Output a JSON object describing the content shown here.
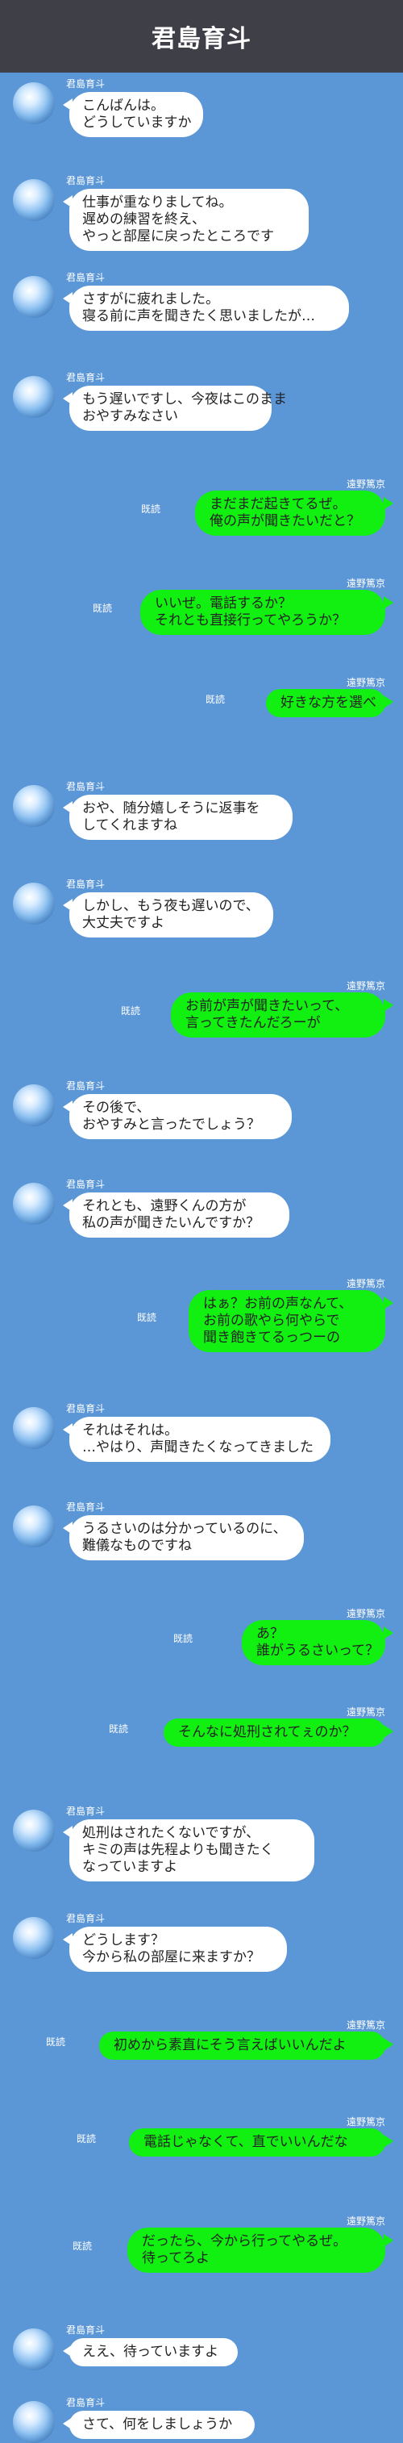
{
  "header": {
    "title": "君島育斗"
  },
  "read_label": "既読",
  "messages": [
    {
      "side": "left",
      "sender": "君島育斗",
      "text": "こんばんは。\nどうしていますか"
    },
    {
      "side": "left",
      "sender": "君島育斗",
      "text": "仕事が重なりましてね。\n遅めの練習を終え、\nやっと部屋に戻ったところです"
    },
    {
      "side": "left",
      "sender": "君島育斗",
      "text": "さすがに疲れました。\n寝る前に声を聞きたく思いましたが…"
    },
    {
      "side": "left",
      "sender": "君島育斗",
      "text": "もう遅いですし、今夜はこのまま\nおやすみなさい"
    },
    {
      "side": "right",
      "sender": "遠野篤京",
      "read": "既読",
      "text": "まだまだ起きてるぜ。\n俺の声が聞きたいだと？"
    },
    {
      "side": "right",
      "sender": "遠野篤京",
      "read": "既読",
      "text": "いいぜ。電話するか？\nそれとも直接行ってやろうか？"
    },
    {
      "side": "right",
      "sender": "遠野篤京",
      "read": "既読",
      "text": "好きな方を選べ"
    },
    {
      "side": "left",
      "sender": "君島育斗",
      "text": "おや、随分嬉しそうに返事を\nしてくれますね"
    },
    {
      "side": "left",
      "sender": "君島育斗",
      "text": "しかし、もう夜も遅いので、\n大丈夫ですよ"
    },
    {
      "side": "right",
      "sender": "遠野篤京",
      "read": "既読",
      "text": "お前が声が聞きたいって、\n言ってきたんだろーが"
    },
    {
      "side": "left",
      "sender": "君島育斗",
      "text": "その後で、\nおやすみと言ったでしょう？"
    },
    {
      "side": "left",
      "sender": "君島育斗",
      "text": "それとも、遠野くんの方が\n私の声が聞きたいんですか？"
    },
    {
      "side": "right",
      "sender": "遠野篤京",
      "read": "既読",
      "text": "はぁ？お前の声なんて、\nお前の歌やら何やらで\n聞き飽きてるっつーの"
    },
    {
      "side": "left",
      "sender": "君島育斗",
      "text": "それはそれは。\n…やはり、声聞きたくなってきました"
    },
    {
      "side": "left",
      "sender": "君島育斗",
      "text": "うるさいのは分かっているのに、\n難儀なものですね"
    },
    {
      "side": "right",
      "sender": "遠野篤京",
      "read": "既読",
      "text": "あ？\n誰がうるさいって？"
    },
    {
      "side": "right",
      "sender": "遠野篤京",
      "read": "既読",
      "text": "そんなに処刑されてぇのか？"
    },
    {
      "side": "left",
      "sender": "君島育斗",
      "text": "処刑はされたくないですが、\nキミの声は先程よりも聞きたく\nなっていますよ"
    },
    {
      "side": "left",
      "sender": "君島育斗",
      "text": "どうします？\n今から私の部屋に来ますか？"
    },
    {
      "side": "right",
      "sender": "遠野篤京",
      "read": "既読",
      "text": "初めから素直にそう言えばいいんだよ"
    },
    {
      "side": "right",
      "sender": "遠野篤京",
      "read": "既読",
      "text": "電話じゃなくて、直でいいんだな"
    },
    {
      "side": "right",
      "sender": "遠野篤京",
      "read": "既読",
      "text": "だったら、今から行ってやるぜ。\n待ってろよ"
    },
    {
      "side": "left",
      "sender": "君島育斗",
      "text": "ええ、待っていますよ"
    },
    {
      "side": "left",
      "sender": "君島育斗",
      "text": "さて、何をしましょうか"
    }
  ]
}
